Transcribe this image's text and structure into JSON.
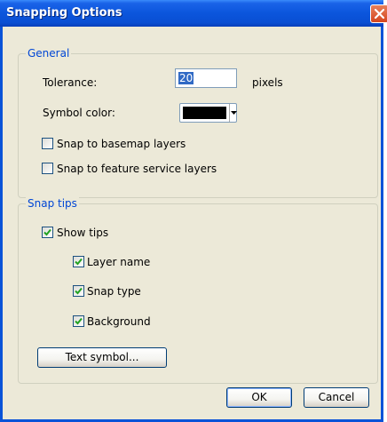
{
  "dialog": {
    "title": "Snapping Options"
  },
  "general": {
    "legend": "General",
    "tolerance_label": "Tolerance:",
    "tolerance_value": "20",
    "tolerance_unit": "pixels",
    "symbol_color_label": "Symbol color:",
    "symbol_color": "#000000",
    "snap_basemap_label": "Snap to basemap layers",
    "snap_basemap_checked": false,
    "snap_feature_label": "Snap to feature service layers",
    "snap_feature_checked": false
  },
  "snap_tips": {
    "legend": "Snap tips",
    "show_tips_label": "Show tips",
    "show_tips_checked": true,
    "layer_name_label": "Layer name",
    "layer_name_checked": true,
    "snap_type_label": "Snap type",
    "snap_type_checked": true,
    "background_label": "Background",
    "background_checked": true,
    "text_symbol_button": "Text symbol..."
  },
  "buttons": {
    "ok": "OK",
    "cancel": "Cancel"
  },
  "colors": {
    "title_bar": "#0a53d8",
    "dialog_face": "#ece9d8",
    "group_legend": "#0046d5",
    "check_mark": "#21a121",
    "close_button": "#d4451e"
  },
  "icons": {
    "close": "close-icon",
    "dropdown": "chevron-down-icon",
    "check": "check-icon"
  }
}
